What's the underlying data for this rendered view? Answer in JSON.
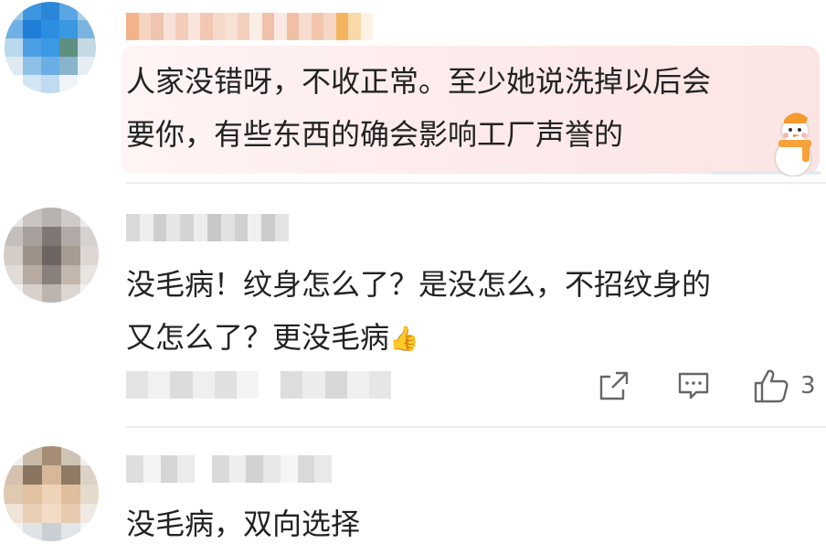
{
  "comments": [
    {
      "text_line1": "人家没错呀，不收正常。至少她说洗掉以后会",
      "text_line2": "要你，有些东西的确会影响工厂声誉的",
      "decoration_icon": "snowman-icon"
    },
    {
      "text_line1": "没毛病！纹身怎么了？是没怎么，不招纹身的",
      "text_line2": "又怎么了？更没毛病",
      "emoji": "👍",
      "like_count": "3",
      "actions": [
        "share-icon",
        "comment-icon",
        "thumbs-up-icon"
      ]
    },
    {
      "text_line1": "没毛病，双向选择"
    }
  ],
  "colors": {
    "text": "#222222",
    "icon": "#666666",
    "highlight_bg": "#fdeaea",
    "divider": "#eeeeee"
  }
}
